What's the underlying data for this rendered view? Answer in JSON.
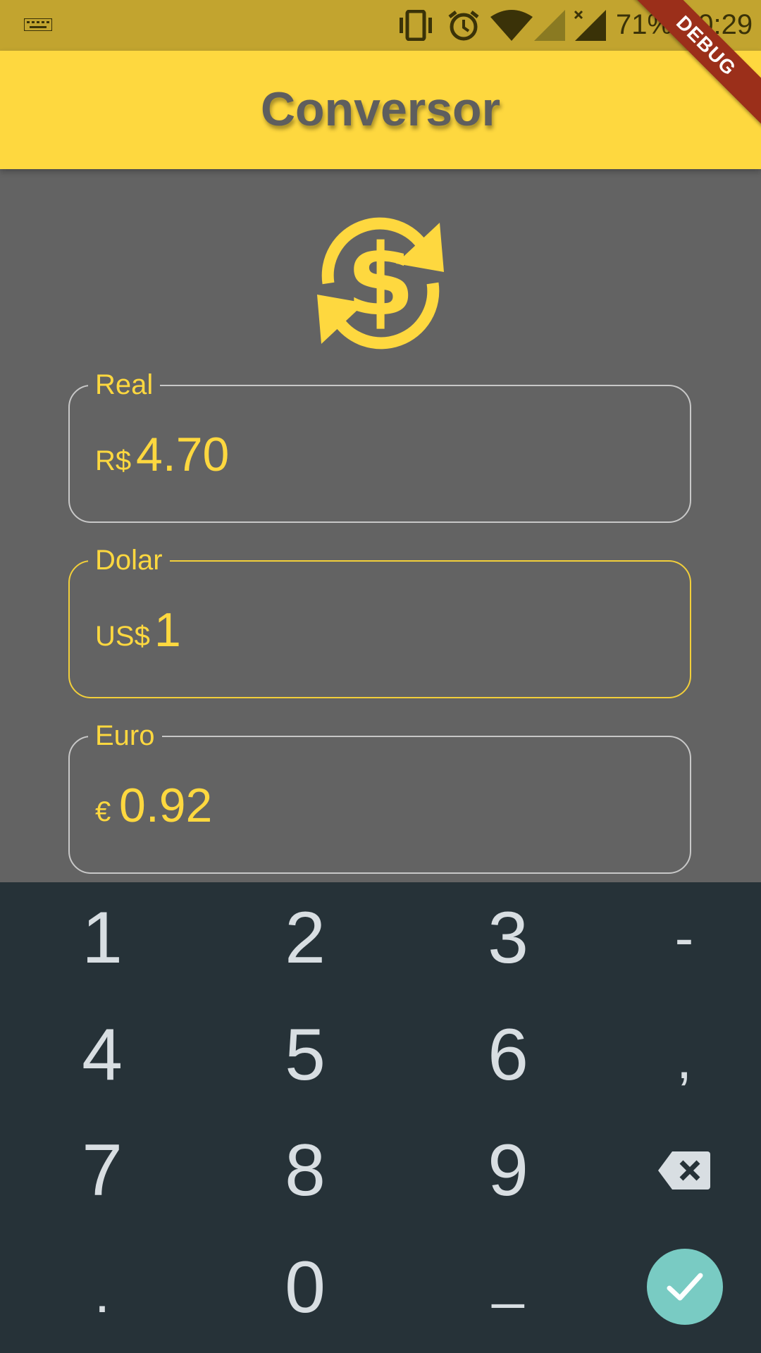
{
  "status_bar": {
    "battery_percent": "71%",
    "time": "10:29",
    "icons": [
      "keyboard-icon",
      "vibrate-icon",
      "alarm-icon",
      "wifi-icon",
      "signal-icon",
      "signal-no-data-icon"
    ]
  },
  "app_bar": {
    "title": "Conversor"
  },
  "debug_banner": "DEBUG",
  "hero_icon": "currency-exchange-icon",
  "fields": {
    "real": {
      "label": "Real",
      "prefix": "R$",
      "value": "4.70"
    },
    "dolar": {
      "label": "Dolar",
      "prefix": "US$",
      "value": "1"
    },
    "euro": {
      "label": "Euro",
      "prefix": "€",
      "value": "0.92"
    }
  },
  "keyboard": {
    "keys": {
      "k1": "1",
      "k2": "2",
      "k3": "3",
      "minus": "-",
      "k4": "4",
      "k5": "5",
      "k6": "6",
      "comma": ",",
      "k7": "7",
      "k8": "8",
      "k9": "9",
      "period": ".",
      "k0": "0",
      "space": "_"
    },
    "backspace_icon": "backspace-icon",
    "confirm_icon": "check-icon"
  },
  "colors": {
    "accent": "#fed83f",
    "status_bar": "#c2a42f",
    "background": "#636363",
    "keyboard_bg": "#263238",
    "confirm_button": "#79cbc3",
    "debug_ribbon": "#9b2f1a"
  }
}
